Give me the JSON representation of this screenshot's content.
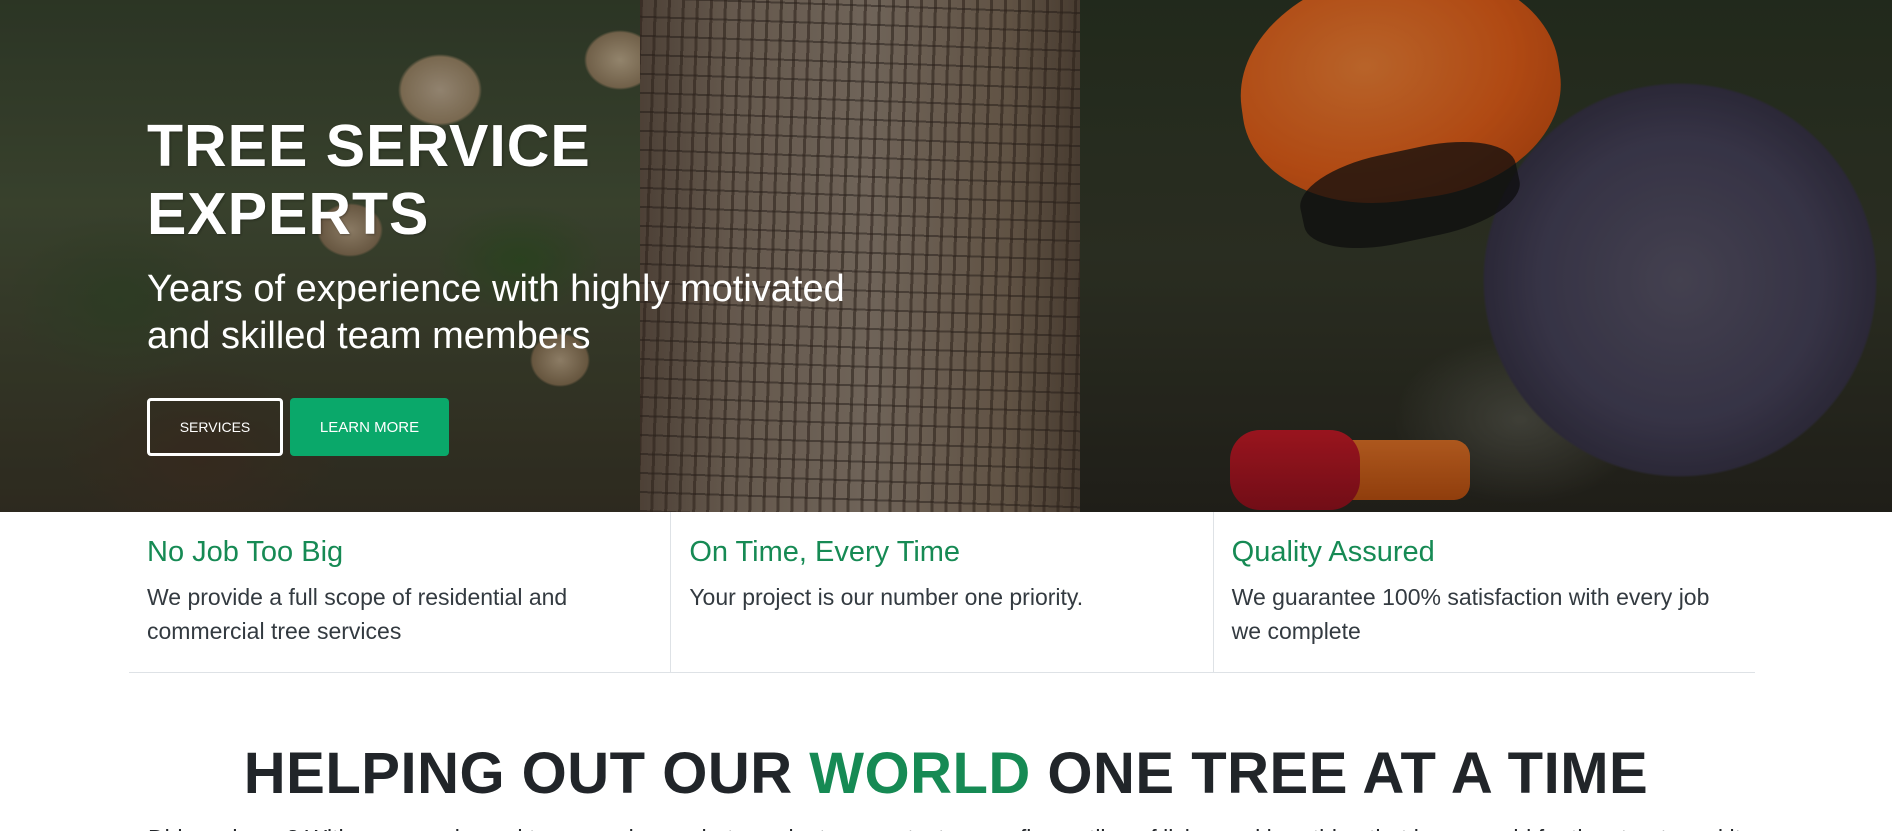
{
  "hero": {
    "title_line1": "TREE SERVICE",
    "title_line2": "EXPERTS",
    "subtitle_line1": "Years of experience with highly motivated",
    "subtitle_line2": "and skilled team members",
    "services_button": "SERVICES",
    "learn_more_button": "LEARN MORE"
  },
  "features": [
    {
      "title": "No Job Too Big",
      "text": "We provide a full scope of residential and commercial tree services"
    },
    {
      "title": "On Time, Every Time",
      "text": "Your project is our number one priority."
    },
    {
      "title": "Quality Assured",
      "text": "We guarantee 100% satisfaction with every job we complete"
    }
  ],
  "section": {
    "heading_before": "HELPING OUT OUR ",
    "heading_accent": "WORLD",
    "heading_after": " ONE TREE AT A TIME",
    "intro_text": "Did you know? With our experienced team, we keep what we plant, we protect: every fine outline of living and breathing that is our world for the streets and its trails"
  },
  "colors": {
    "accent_green": "#168a54",
    "button_green": "#0aa86a",
    "text_dark": "#212529"
  }
}
